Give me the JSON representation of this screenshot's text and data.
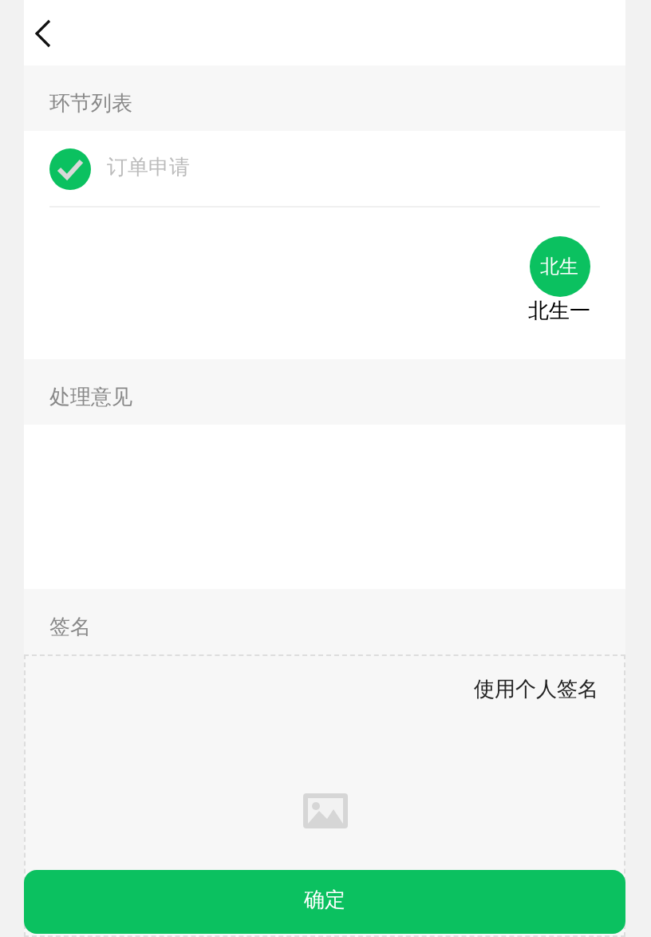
{
  "sections": [
    {
      "kind": "steps",
      "title": "环节列表",
      "steps": [
        {
          "label": "订单申请",
          "done": true
        }
      ],
      "approvers": [
        {
          "avatar": "北生",
          "name": "北生一"
        }
      ]
    },
    {
      "kind": "opinion",
      "title": "处理意见"
    },
    {
      "kind": "signature",
      "title": "签名",
      "link": "使用个人签名"
    }
  ],
  "confirm_button": "确定"
}
